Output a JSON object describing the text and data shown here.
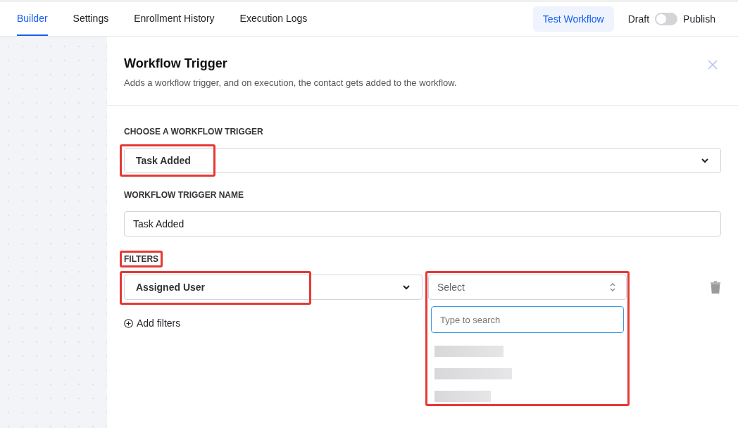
{
  "tabs": [
    {
      "label": "Builder",
      "selected": true
    },
    {
      "label": "Settings",
      "selected": false
    },
    {
      "label": "Enrollment History",
      "selected": false
    },
    {
      "label": "Execution Logs",
      "selected": false
    }
  ],
  "test_button": "Test Workflow",
  "publish_toggle": {
    "off_label": "Draft",
    "on_label": "Publish",
    "on": false
  },
  "panel": {
    "title": "Workflow Trigger",
    "description": "Adds a workflow trigger, and on execution, the contact gets added to the workflow.",
    "trigger_label": "CHOOSE A WORKFLOW TRIGGER",
    "trigger_value": "Task Added",
    "name_label": "WORKFLOW TRIGGER NAME",
    "name_value": "Task Added",
    "filters_label": "FILTERS",
    "filter": {
      "field": "Assigned User",
      "value_placeholder": "Select",
      "search_placeholder": "Type to search",
      "options": [
        {
          "kind": "blurred"
        },
        {
          "kind": "blurred"
        },
        {
          "kind": "blurred"
        }
      ]
    },
    "add_filters": "Add filters"
  }
}
